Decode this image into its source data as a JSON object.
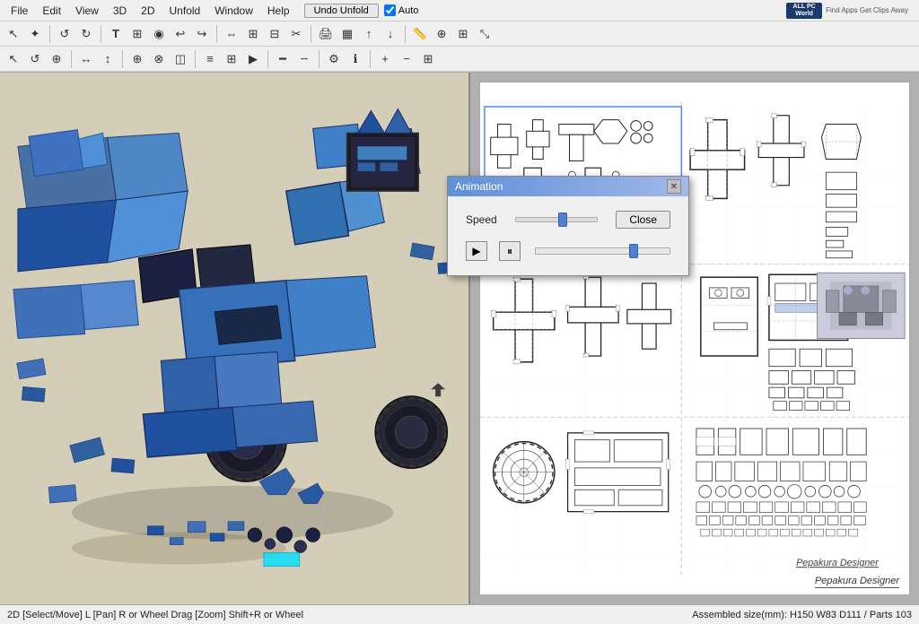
{
  "app": {
    "title": "Pepakura Designer",
    "brand": "ALL PC World",
    "brand_sub": "Find Apps Get Clips Away"
  },
  "menubar": {
    "items": [
      "File",
      "Edit",
      "View",
      "3D",
      "2D",
      "Unfold",
      "Window",
      "Help"
    ],
    "undo_unfold": "Undo Unfold",
    "auto_label": "Auto"
  },
  "toolbar1": {
    "buttons": [
      {
        "name": "new",
        "icon": "☐"
      },
      {
        "name": "open",
        "icon": "📂"
      },
      {
        "name": "save",
        "icon": "💾"
      },
      {
        "name": "light",
        "icon": "💡"
      },
      {
        "name": "settings1",
        "icon": "⚙"
      },
      {
        "name": "settings2",
        "icon": "⚙"
      },
      {
        "name": "cursor",
        "icon": "↖"
      },
      {
        "name": "rotate",
        "icon": "↻"
      },
      {
        "name": "person",
        "icon": "♟"
      },
      {
        "name": "link",
        "icon": "🔗"
      },
      {
        "name": "pointer",
        "icon": "⊕"
      },
      {
        "name": "rect",
        "icon": "▭"
      },
      {
        "name": "fold",
        "icon": "◫"
      }
    ]
  },
  "toolbar2": {
    "buttons": [
      {
        "name": "select",
        "icon": "↖"
      },
      {
        "name": "move",
        "icon": "✋"
      },
      {
        "name": "rotate2",
        "icon": "↺"
      },
      {
        "name": "text",
        "icon": "T"
      },
      {
        "name": "image",
        "icon": "🖼"
      },
      {
        "name": "3d-rotate",
        "icon": "◉"
      },
      {
        "name": "undo",
        "icon": "↩"
      },
      {
        "name": "redo",
        "icon": "↪"
      },
      {
        "name": "sep1",
        "icon": "|"
      },
      {
        "name": "mirror",
        "icon": "⇔"
      },
      {
        "name": "group",
        "icon": "⊞"
      },
      {
        "name": "ungroup",
        "icon": "⊟"
      },
      {
        "name": "arrange",
        "icon": "≡"
      },
      {
        "name": "print",
        "icon": "🖨"
      },
      {
        "name": "print2",
        "icon": "🖨"
      },
      {
        "name": "export",
        "icon": "📤"
      },
      {
        "name": "import",
        "icon": "📥"
      },
      {
        "name": "measure",
        "icon": "📏"
      },
      {
        "name": "zoom",
        "icon": "🔍"
      },
      {
        "name": "grid",
        "icon": "⊞"
      },
      {
        "name": "size",
        "icon": "⤡"
      }
    ]
  },
  "animation_dialog": {
    "title": "Animation",
    "speed_label": "Speed",
    "close_btn": "Close",
    "speed_pct": 55,
    "progress_pct": 72
  },
  "status_bar": {
    "left": "2D [Select/Move] L [Pan] R or Wheel Drag [Zoom] Shift+R or Wheel",
    "right": "Assembled size(mm): H150 W83 D111 / Parts 103"
  }
}
